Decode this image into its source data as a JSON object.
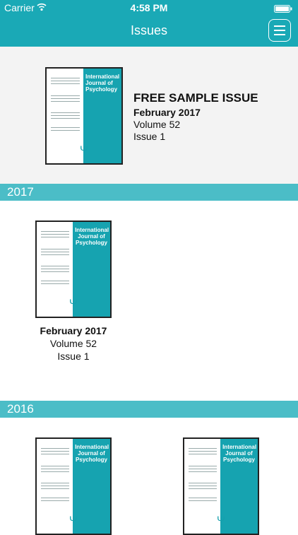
{
  "status_bar": {
    "carrier": "Carrier",
    "wifi_icon": "wifi-icon",
    "time": "4:58 PM",
    "battery_icon": "battery-icon"
  },
  "nav": {
    "title": "Issues",
    "menu_icon": "hamburger-menu-icon"
  },
  "cover": {
    "journal_title": "International Journal of Psychology",
    "publisher_mark": "IUPsyS"
  },
  "featured": {
    "label": "FREE SAMPLE ISSUE",
    "date": "February 2017",
    "volume": "Volume 52",
    "issue": "Issue 1"
  },
  "sections": [
    {
      "year": "2017",
      "issues": [
        {
          "date": "February 2017",
          "volume": "Volume 52",
          "issue": "Issue 1"
        }
      ]
    },
    {
      "year": "2016",
      "issues": [
        {
          "date": "",
          "volume": "",
          "issue": ""
        },
        {
          "date": "",
          "volume": "",
          "issue": ""
        }
      ]
    }
  ],
  "colors": {
    "brand_teal": "#1aa9b6",
    "section_header": "#4bbdc7",
    "cover_teal": "#16a3b0"
  }
}
